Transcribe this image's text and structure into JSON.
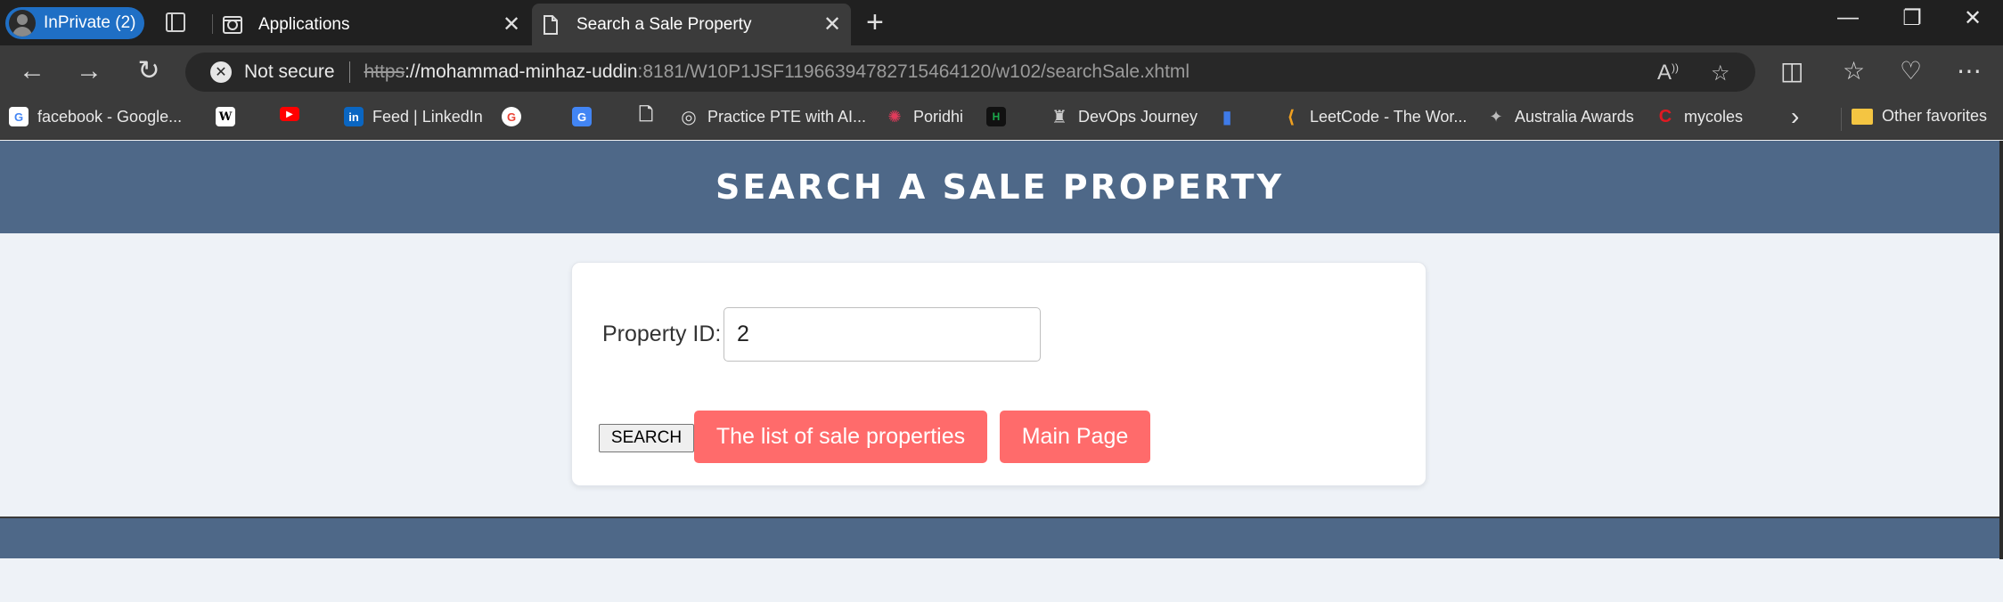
{
  "browser": {
    "profile_label": "InPrivate (2)",
    "tabs": [
      {
        "title": "Applications",
        "icon": "apps-favicon",
        "active": false
      },
      {
        "title": "Search a Sale Property",
        "icon": "page-icon",
        "active": true
      }
    ],
    "window_controls": {
      "minimize": "—",
      "restore": "❐",
      "close": "✕"
    },
    "address": {
      "security_label": "Not secure",
      "url_scheme": "https",
      "url_host": "://mohammad-minhaz-uddin",
      "url_rest": ":8181/W10P1JSF11966394782715464120/w102/searchSale.xhtml"
    },
    "favorites": [
      {
        "label": "facebook - Google...",
        "icon": "google-icon",
        "color": "#4285f4",
        "glyph": "G"
      },
      {
        "label": "",
        "icon": "wikipedia-icon",
        "color": "#ffffff",
        "glyph": "W"
      },
      {
        "label": "",
        "icon": "youtube-icon",
        "color": "#ff0000",
        "glyph": "▶"
      },
      {
        "label": "Feed | LinkedIn",
        "icon": "linkedin-icon",
        "color": "#0a66c2",
        "glyph": "in"
      },
      {
        "label": "",
        "icon": "google-icon",
        "color": "#4285f4",
        "glyph": "G"
      },
      {
        "label": "",
        "icon": "google-translate-icon",
        "color": "#4285f4",
        "glyph": "G"
      },
      {
        "label": "",
        "icon": "document-icon",
        "color": "#3b3b3b",
        "glyph": "🗋"
      },
      {
        "label": "Practice PTE with AI...",
        "icon": "pte-icon",
        "color": "#3b3b3b",
        "glyph": "◎"
      },
      {
        "label": "Poridhi",
        "icon": "poridhi-icon",
        "color": "#3b3b3b",
        "glyph": "✺"
      },
      {
        "label": "",
        "icon": "hackerrank-icon",
        "color": "#1ba94c",
        "glyph": "H"
      },
      {
        "label": "DevOps Journey",
        "icon": "devops-icon",
        "color": "#3b3b3b",
        "glyph": "♜"
      },
      {
        "label": "",
        "icon": "chart-favicon-icon",
        "color": "#3b3b3b",
        "glyph": "▮"
      },
      {
        "label": "LeetCode - The Wor...",
        "icon": "leetcode-icon",
        "color": "#3b3b3b",
        "glyph": "⟨"
      },
      {
        "label": "Australia Awards",
        "icon": "australia-awards-icon",
        "color": "#3b3b3b",
        "glyph": "✦"
      },
      {
        "label": "mycoles",
        "icon": "coles-icon",
        "color": "#e01a22",
        "glyph": "C"
      }
    ],
    "more_favorites": "›",
    "other_favorites": "Other favorites"
  },
  "page": {
    "title": "SEARCH A SALE PROPERTY",
    "form": {
      "property_id_label": "Property ID:",
      "property_id_value": "2",
      "search_button": "SEARCH",
      "list_button": "The list of sale properties",
      "main_button": "Main Page"
    }
  },
  "colors": {
    "header": "#4e6888",
    "button_red": "#ff6b6b",
    "page_bg": "#eef2f7"
  }
}
